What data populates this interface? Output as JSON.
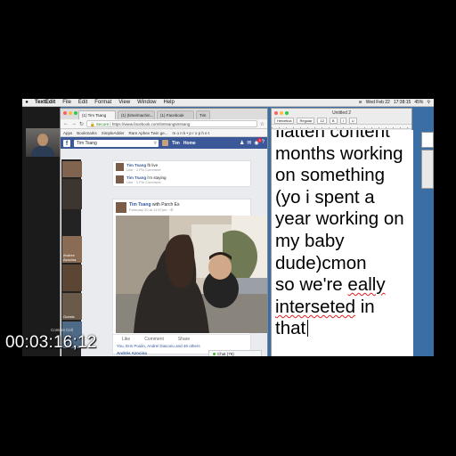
{
  "menubar": {
    "app": "TextEdit",
    "items": [
      "File",
      "Edit",
      "Format",
      "View",
      "Window",
      "Help"
    ],
    "status": [
      "Wed Feb 22",
      "17:38:15",
      "45%"
    ]
  },
  "browser": {
    "tabs": [
      "(1) Tim Tsang",
      "(1) (time/machin...",
      "(1) Facebook",
      "Tim"
    ],
    "url_secure": "Secure",
    "url": "https://www.facebook.com/timtsangtimtsang",
    "bookmarks": [
      "Apps",
      "Bookmarks",
      "SimpleAdder",
      "Rare Aphex Twin ge...",
      "m o n k • p r o p h e t"
    ],
    "fb_search": "Tim Tsang",
    "fb_user": "Tim",
    "fb_home": "Home",
    "fb_badge": "3",
    "comments": [
      {
        "name": "Tim Tsang",
        "text": "fb live",
        "actions": "Like · 1 Pin Comment"
      },
      {
        "name": "Tim Tsang",
        "text": "i'm staying",
        "actions": "Like · 1 Pin Comment"
      }
    ],
    "post": {
      "name": "Tim Tsang",
      "with": "with Parch Es",
      "time": "February 20 at 11:57pm · ⚙",
      "actions": [
        "Like",
        "Comment",
        "Share"
      ],
      "reactions": "You, Erin Poulin, Andrei Diaconu and 49 others",
      "commenter": "Andrés Azocina"
    },
    "chat": "Chat (79)"
  },
  "thumbs": [
    "Andres Azocina",
    "Guests",
    ""
  ],
  "textedit": {
    "title": "Untitled 2",
    "toolbar": [
      "Helvetica",
      "Regular",
      "12",
      "B",
      "I",
      "U"
    ],
    "lines": [
      "flatten content",
      "months working",
      "on something",
      "(yo i spent a",
      "year working on",
      "my baby",
      "dude)cmon",
      "so we're eally",
      "interseted in",
      "that"
    ],
    "misspelled": [
      "eally",
      "interseted"
    ]
  },
  "overlay": {
    "timecode": "00:03:16;12",
    "content_cell": "Content Cell"
  },
  "colors": {
    "fb_blue": "#3b5998",
    "desktop": "#3a6ea5",
    "spell_underline": "#e02020"
  }
}
